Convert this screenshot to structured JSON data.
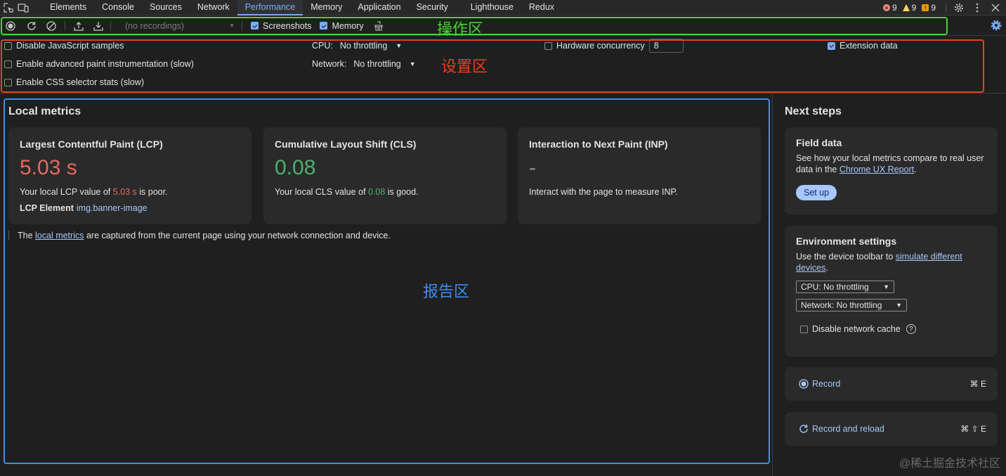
{
  "tabs": [
    "Elements",
    "Console",
    "Sources",
    "Network",
    "Performance",
    "Memory",
    "Application",
    "Security",
    "Lighthouse",
    "Redux"
  ],
  "active_tab": "Performance",
  "status": {
    "errors": "9",
    "warnings": "9",
    "issues": "9"
  },
  "toolbar": {
    "recordings_placeholder": "(no recordings)",
    "screenshots_label": "Screenshots",
    "memory_label": "Memory"
  },
  "settings": {
    "disable_js_samples": "Disable JavaScript samples",
    "advanced_paint": "Enable advanced paint instrumentation (slow)",
    "css_selector_stats": "Enable CSS selector stats (slow)",
    "cpu_label": "CPU:",
    "cpu_value": "No throttling",
    "network_label": "Network:",
    "network_value": "No throttling",
    "hardware_concurrency_label": "Hardware concurrency",
    "hardware_concurrency_value": "8",
    "extension_data": "Extension data"
  },
  "local_metrics": {
    "title": "Local metrics",
    "lcp": {
      "title": "Largest Contentful Paint (LCP)",
      "value": "5.03 s",
      "desc_pre": "Your local LCP value of ",
      "desc_value": "5.03 s",
      "desc_post": " is poor.",
      "element_label": "LCP Element",
      "element_value": "img.banner-image"
    },
    "cls": {
      "title": "Cumulative Layout Shift (CLS)",
      "value": "0.08",
      "desc_pre": "Your local CLS value of ",
      "desc_value": "0.08",
      "desc_post": " is good."
    },
    "inp": {
      "title": "Interaction to Next Paint (INP)",
      "value": "-",
      "desc": "Interact with the page to measure INP."
    },
    "footnote_pre": "The ",
    "footnote_link": "local metrics",
    "footnote_post": " are captured from the current page using your network connection and device."
  },
  "next_steps": {
    "title": "Next steps",
    "field_data": {
      "title": "Field data",
      "text_pre": "See how your local metrics compare to real user data in the ",
      "link": "Chrome UX Report",
      "text_post": ".",
      "button": "Set up"
    },
    "environment": {
      "title": "Environment settings",
      "text_pre": "Use the device toolbar to ",
      "link": "simulate different devices",
      "text_post": ".",
      "cpu_select": "CPU: No throttling",
      "network_select": "Network: No throttling",
      "disable_cache": "Disable network cache"
    },
    "record": {
      "label": "Record",
      "shortcut": "⌘ E"
    },
    "record_reload": {
      "label": "Record and reload",
      "shortcut": "⌘ ⇧ E"
    }
  },
  "annotations": {
    "action_area": "操作区",
    "settings_area": "设置区",
    "report_area": "报告区"
  },
  "watermark": "@稀土掘金技术社区",
  "colors": {
    "green": "#4cd137",
    "red": "#e8401c",
    "blue": "#3d8ef0",
    "accent": "#7cacf8"
  }
}
